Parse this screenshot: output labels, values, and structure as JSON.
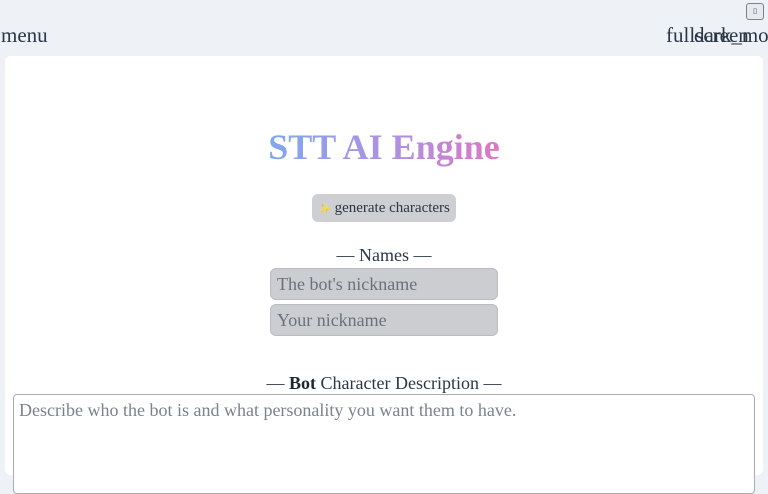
{
  "header": {
    "menu_label": "menu",
    "fullscreen_label": "fullscreen",
    "dark_mode_label": "dark_mode",
    "small_button_glyph": "▯"
  },
  "main": {
    "title": "STT AI Engine",
    "generate_button": {
      "icon": "sparkle-icon",
      "icon_glyph": "✨",
      "label": "generate characters"
    },
    "names_section": {
      "label": "— Names —",
      "bot_nickname_placeholder": "The bot's nickname",
      "bot_nickname_value": "",
      "user_nickname_placeholder": "Your nickname",
      "user_nickname_value": ""
    },
    "description_section": {
      "label_prefix": "— ",
      "label_bold": "Bot",
      "label_suffix": " Character Description —",
      "placeholder": "Describe who the bot is and what personality you want them to have.",
      "value": ""
    }
  },
  "colors": {
    "page_background": "#eef2f7",
    "card_background": "#ffffff",
    "title_gradient_start": "#7fa8ef",
    "title_gradient_end": "#df76c3",
    "button_background": "#cdcfd3",
    "field_background": "#cbcdd1"
  }
}
